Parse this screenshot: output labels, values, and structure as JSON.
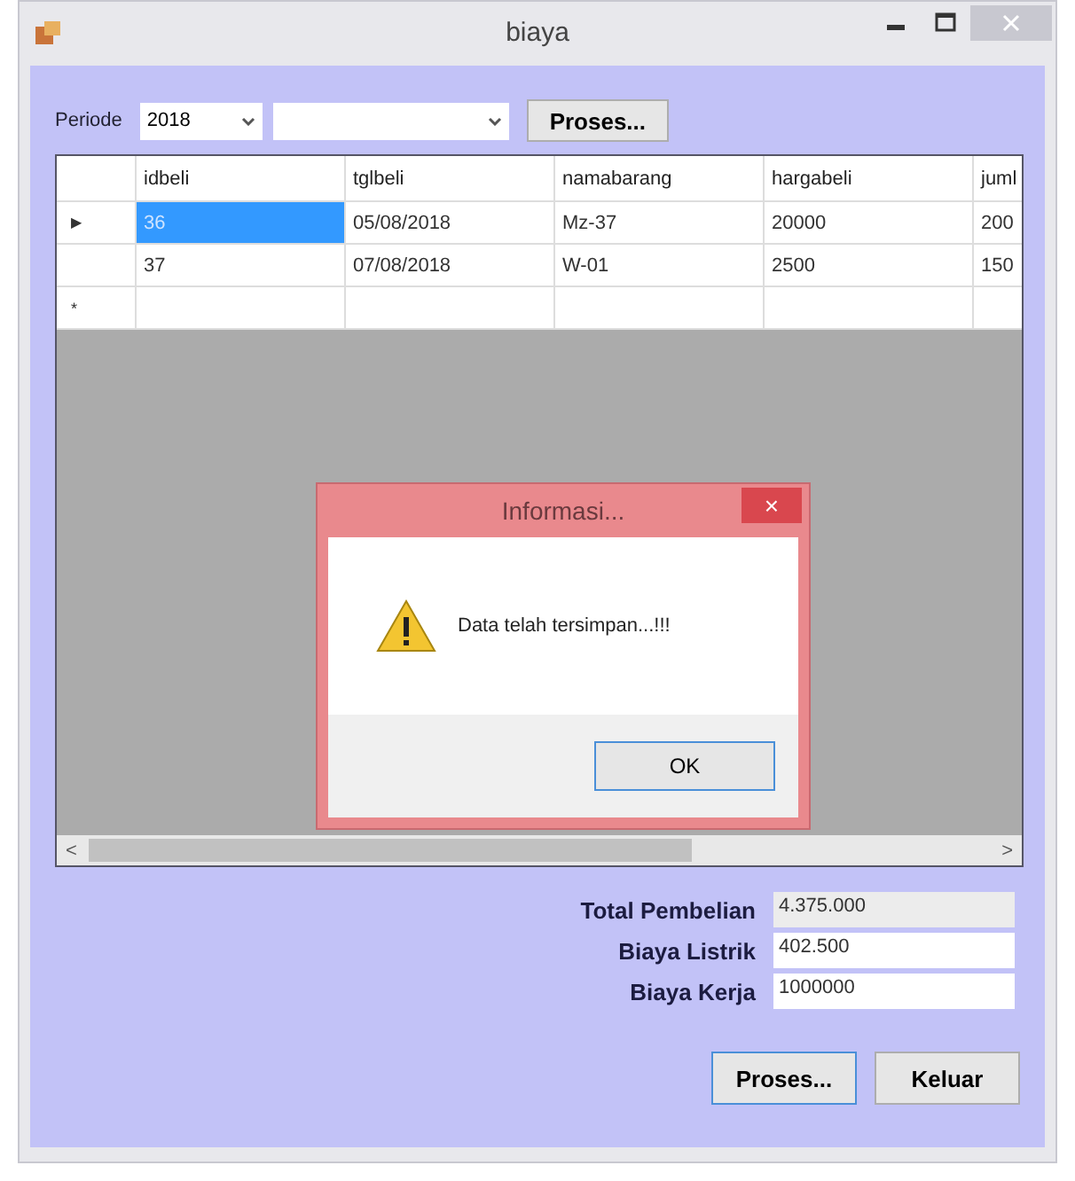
{
  "window": {
    "title": "biaya"
  },
  "filter": {
    "label": "Periode",
    "year": "2018",
    "button": "Proses..."
  },
  "table": {
    "columns": [
      "idbeli",
      "tglbeli",
      "namabarang",
      "hargabeli",
      "juml"
    ],
    "rows": [
      {
        "kind": "data",
        "marker": "▶",
        "selected": true,
        "cells": [
          "36",
          "05/08/2018",
          "Mz-37",
          "20000",
          "200"
        ]
      },
      {
        "kind": "data",
        "marker": "",
        "selected": false,
        "cells": [
          "37",
          "07/08/2018",
          "W-01",
          "2500",
          "150"
        ]
      },
      {
        "kind": "new",
        "marker": "*",
        "selected": false,
        "cells": [
          "",
          "",
          "",
          "",
          ""
        ]
      }
    ],
    "scroll_left": "<",
    "scroll_right": ">"
  },
  "summary": [
    {
      "label": "Total Pembelian",
      "value": "4.375.000",
      "disabled": true
    },
    {
      "label": "Biaya Listrik",
      "value": "402.500",
      "disabled": false
    },
    {
      "label": "Biaya Kerja",
      "value": "1000000",
      "disabled": false
    }
  ],
  "buttons": [
    {
      "label": "Proses...",
      "selected": true
    },
    {
      "label": "Keluar",
      "selected": false
    }
  ],
  "dialog": {
    "title": "Informasi...",
    "close": "×",
    "message": "Data telah tersimpan...!!!",
    "button": "OK"
  }
}
